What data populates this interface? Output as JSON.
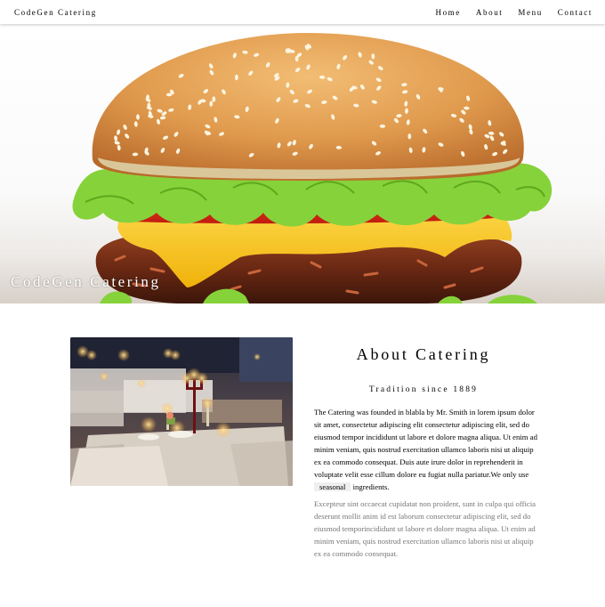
{
  "header": {
    "brand": "CodeGen Catering",
    "nav": [
      "Home",
      "About",
      "Menu",
      "Contact"
    ]
  },
  "hero": {
    "title": "CodeGen Catering",
    "image": "burger-photo"
  },
  "about": {
    "image": "restaurant-table-photo",
    "title": "About Catering",
    "tagline": "Tradition since 1889",
    "paragraph1_before": "The Catering was founded in blabla by Mr. Smith in lorem ipsum dolor sit amet, consectetur adipiscing elit consectetur adipiscing elit, sed do eiusmod tempor incididunt ut labore et dolore magna aliqua. Ut enim ad minim veniam, quis nostrud exercitation ullamco laboris nisi ut aliquip ex ea commodo consequat. Duis aute irure dolor in reprehenderit in voluptate velit esse cillum dolore eu fugiat nulla pariatur.We only use",
    "paragraph1_tag": "seasonal",
    "paragraph1_after": "ingredients.",
    "paragraph2": "Excepteur sint occaecat cupidatat non proident, sunt in culpa qui officia deserunt mollit anim id est laborum consectetur adipiscing elit, sed do eiusmod temporincididunt ut labore et dolore magna aliqua. Ut enim ad minim veniam, quis nostrud exercitation ullamco laboris nisi ut aliquip ex ea commodo consequat."
  },
  "colors": {
    "bun": "#e3a255",
    "lettuce": "#7fce33",
    "tomato": "#e12b1a",
    "cheese": "#f7c20f",
    "patty": "#7b3219"
  }
}
